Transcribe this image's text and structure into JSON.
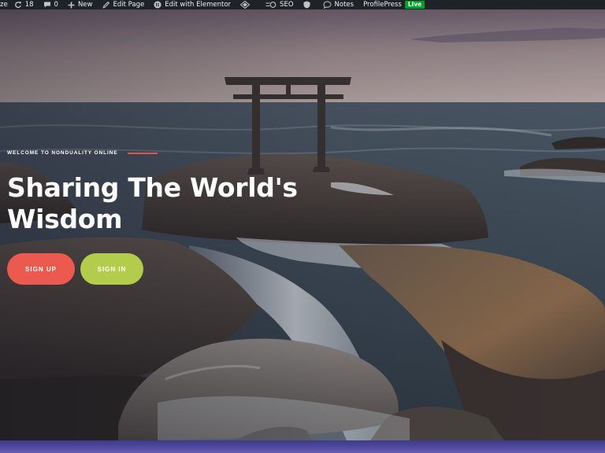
{
  "admin_bar": {
    "site_label": "ze",
    "updates_count": "18",
    "comments_count": "0",
    "new_label": "New",
    "edit_page_label": "Edit Page",
    "elementor_label": "Edit with Elementor",
    "seo_label": "SEO",
    "notes_label": "Notes",
    "profilepress_label": "ProfilePress",
    "live_badge": "Live",
    "colors": {
      "background": "#1d2327",
      "text": "#f0f0f1",
      "live": "#00a32a"
    }
  },
  "hero": {
    "eyebrow": "WELCOME TO NONDUALITY ONLINE",
    "headline": "Sharing The World's Wisdom",
    "buttons": {
      "signup_label": "SIGN UP",
      "signin_label": "SIGN IN"
    },
    "colors": {
      "accent_line": "#e2514c",
      "signup": "#ec5a4f",
      "signin": "#b3cc4c"
    }
  },
  "icons": [
    "wp-refresh-icon",
    "comment-icon",
    "plus-icon",
    "pencil-icon",
    "elementor-icon",
    "diamond-icon",
    "seo-icon",
    "shield-icon",
    "notes-icon"
  ]
}
